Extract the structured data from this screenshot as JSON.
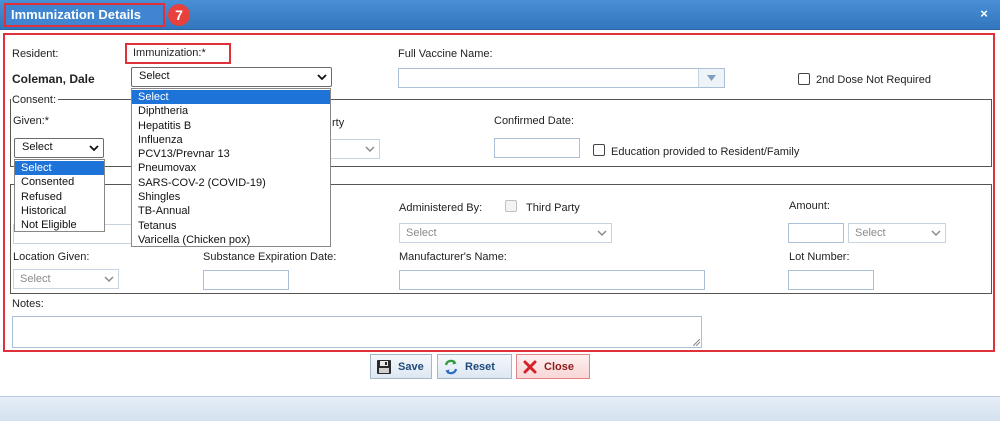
{
  "window": {
    "title": "Immunization Details",
    "step_badge": "7",
    "close_glyph": "×"
  },
  "form": {
    "resident_label": "Resident:",
    "resident_name": "Coleman, Dale",
    "immunization_label": "Immunization:*",
    "immunization_value": "Select",
    "immunization_options": [
      "Select",
      "Diphtheria",
      "Hepatitis B",
      "Influenza",
      "PCV13/Prevnar 13",
      "Pneumovax",
      "SARS-COV-2 (COVID-19)",
      "Shingles",
      "TB-Annual",
      "Tetanus",
      "Varicella (Chicken pox)"
    ],
    "full_vaccine_label": "Full Vaccine Name:",
    "second_dose_label": "2nd Dose Not Required",
    "consent_legend": "Consent:",
    "given_label": "Given:*",
    "given_value": "Select",
    "given_options": [
      "Select",
      "Consented",
      "Refused",
      "Historical",
      "Not Eligible"
    ],
    "third_party_partial": "rty",
    "confirmed_date_label": "Confirmed Date:",
    "education_label": "Education provided to Resident/Family",
    "administered_by_label": "Administered By:",
    "third_party_label": "Third Party",
    "administered_select": "Select",
    "amount_label": "Amount:",
    "amount_unit_select": "Select",
    "location_label": "Location Given:",
    "location_select": "Select",
    "substance_exp_label": "Substance Expiration Date:",
    "manufacturer_label": "Manufacturer's Name:",
    "lot_label": "Lot Number:",
    "notes_label": "Notes:"
  },
  "buttons": {
    "save": "Save",
    "reset": "Reset",
    "close": "Close"
  },
  "colors": {
    "title_bar": "#3f85cf",
    "highlight_red": "#e0303a",
    "selected_option": "#1e73d9"
  },
  "icons": {
    "save": "floppy-disk-icon",
    "reset": "refresh-arrows-icon",
    "close": "red-x-icon"
  }
}
